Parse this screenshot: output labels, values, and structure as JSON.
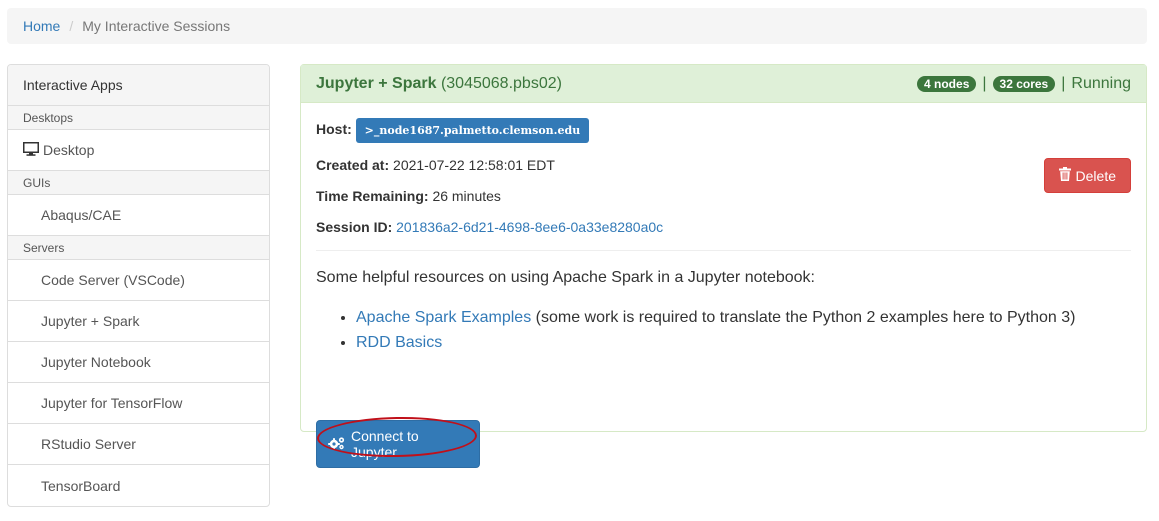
{
  "breadcrumb": {
    "home": "Home",
    "separator": "/",
    "current": "My Interactive Sessions"
  },
  "sidebar": {
    "heading": "Interactive Apps",
    "categories": {
      "desktops": "Desktops",
      "guis": "GUIs",
      "servers": "Servers"
    },
    "items": {
      "desktop": "Desktop",
      "abaqus": "Abaqus/CAE",
      "code_server": "Code Server (VSCode)",
      "jupyter_spark": "Jupyter + Spark",
      "jupyter_notebook": "Jupyter Notebook",
      "jupyter_tensorflow": "Jupyter for TensorFlow",
      "rstudio": "RStudio Server",
      "tensorboard": "TensorBoard"
    }
  },
  "session": {
    "title": "Jupyter + Spark",
    "job_id": "(3045068.pbs02)",
    "nodes_badge": "4 nodes",
    "cores_badge": "32 cores",
    "pipe": "|",
    "status": "Running",
    "host_label": "Host:",
    "host_value": ">_node1687.palmetto.clemson.edu",
    "created_label": "Created at:",
    "created_value": "2021-07-22 12:58:01 EDT",
    "remaining_label": "Time Remaining:",
    "remaining_value": "26 minutes",
    "session_id_label": "Session ID:",
    "session_id_value": "201836a2-6d21-4698-8ee6-0a33e8280a0c",
    "delete_label": "Delete",
    "help_text": "Some helpful resources on using Apache Spark in a Jupyter notebook:",
    "link1_label": "Apache Spark Examples",
    "link1_suffix": " (some work is required to translate the Python 2 examples here to Python 3)",
    "link2_label": "RDD Basics",
    "connect_label": "Connect to Jupyter"
  },
  "colors": {
    "success_header_bg": "#dff0d8",
    "success_text": "#3c763d",
    "primary": "#337ab7",
    "danger": "#d9534f",
    "annotation": "#c0101a"
  }
}
